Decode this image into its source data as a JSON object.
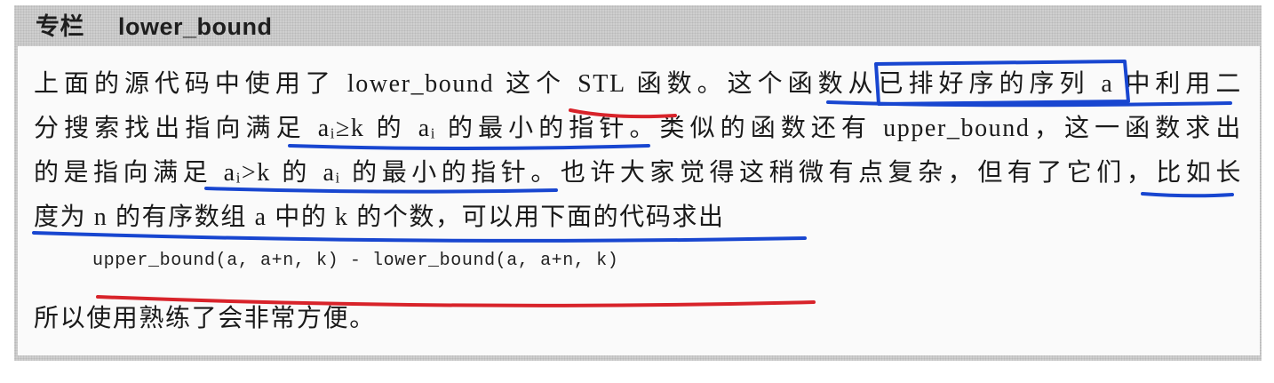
{
  "title": {
    "label": "专栏",
    "name": "lower_bound"
  },
  "paragraph": {
    "line1": "上面的源代码中使用了 lower_bound 这个 STL 函数。这个函数从已排好序的序列 a 中利用二",
    "line2": "分搜索找出指向满足 aᵢ≥k 的 aᵢ 的最小的指针。类似的函数还有 upper_bound，这一函数求出",
    "line3": "的是指向满足 aᵢ>k 的 aᵢ 的最小的指针。也许大家觉得这稍微有点复杂，但有了它们，比如长",
    "line4": "度为 n 的有序数组 a 中的 k 的个数，可以用下面的代码求出"
  },
  "code": "upper_bound(a, a+n, k) - lower_bound(a, a+n, k)",
  "closing": "所以使用熟练了会非常方便。",
  "colors": {
    "blue_mark": "#1846d0",
    "red_mark": "#d8232a"
  }
}
